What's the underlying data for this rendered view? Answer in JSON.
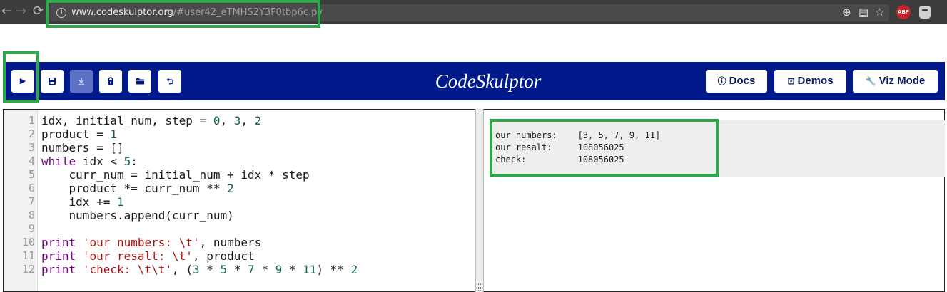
{
  "browser": {
    "url_host": "www.codeskulptor.org",
    "url_path": "/#user42_eTMHS2Y3F0tbp6c.py",
    "info_icon": "i",
    "back_icon": "back-arrow-icon",
    "forward_icon": "forward-arrow-icon",
    "reload_icon": "reload-icon",
    "extension_abp_label": "ABP"
  },
  "toolbar": {
    "run_icon": "▶",
    "buttons": [
      {
        "name": "run-button",
        "icon": "play-icon"
      },
      {
        "name": "save-button",
        "icon": "save-icon"
      },
      {
        "name": "download-button",
        "icon": "download-icon"
      },
      {
        "name": "fresh-url-button",
        "icon": "lock-icon"
      },
      {
        "name": "open-local-button",
        "icon": "folder-icon"
      },
      {
        "name": "reset-button",
        "icon": "undo-icon"
      }
    ]
  },
  "header": {
    "title": "CodeSkulptor",
    "docs_label": "Docs",
    "demos_label": "Demos",
    "viz_label": "Viz Mode"
  },
  "editor": {
    "line_numbers": [
      "1",
      "2",
      "3",
      "4",
      "5",
      "6",
      "7",
      "8",
      "9",
      "10",
      "11",
      "12"
    ]
  },
  "output": {
    "lines": [
      "our numbers:    [3, 5, 7, 9, 11]",
      "our resalt:     108056025",
      "check:          108056025"
    ]
  },
  "colors": {
    "header_bg": "#001a8c",
    "highlight": "#2aa84a",
    "keyword": "#770088",
    "string": "#aa1111",
    "number": "#116644"
  }
}
